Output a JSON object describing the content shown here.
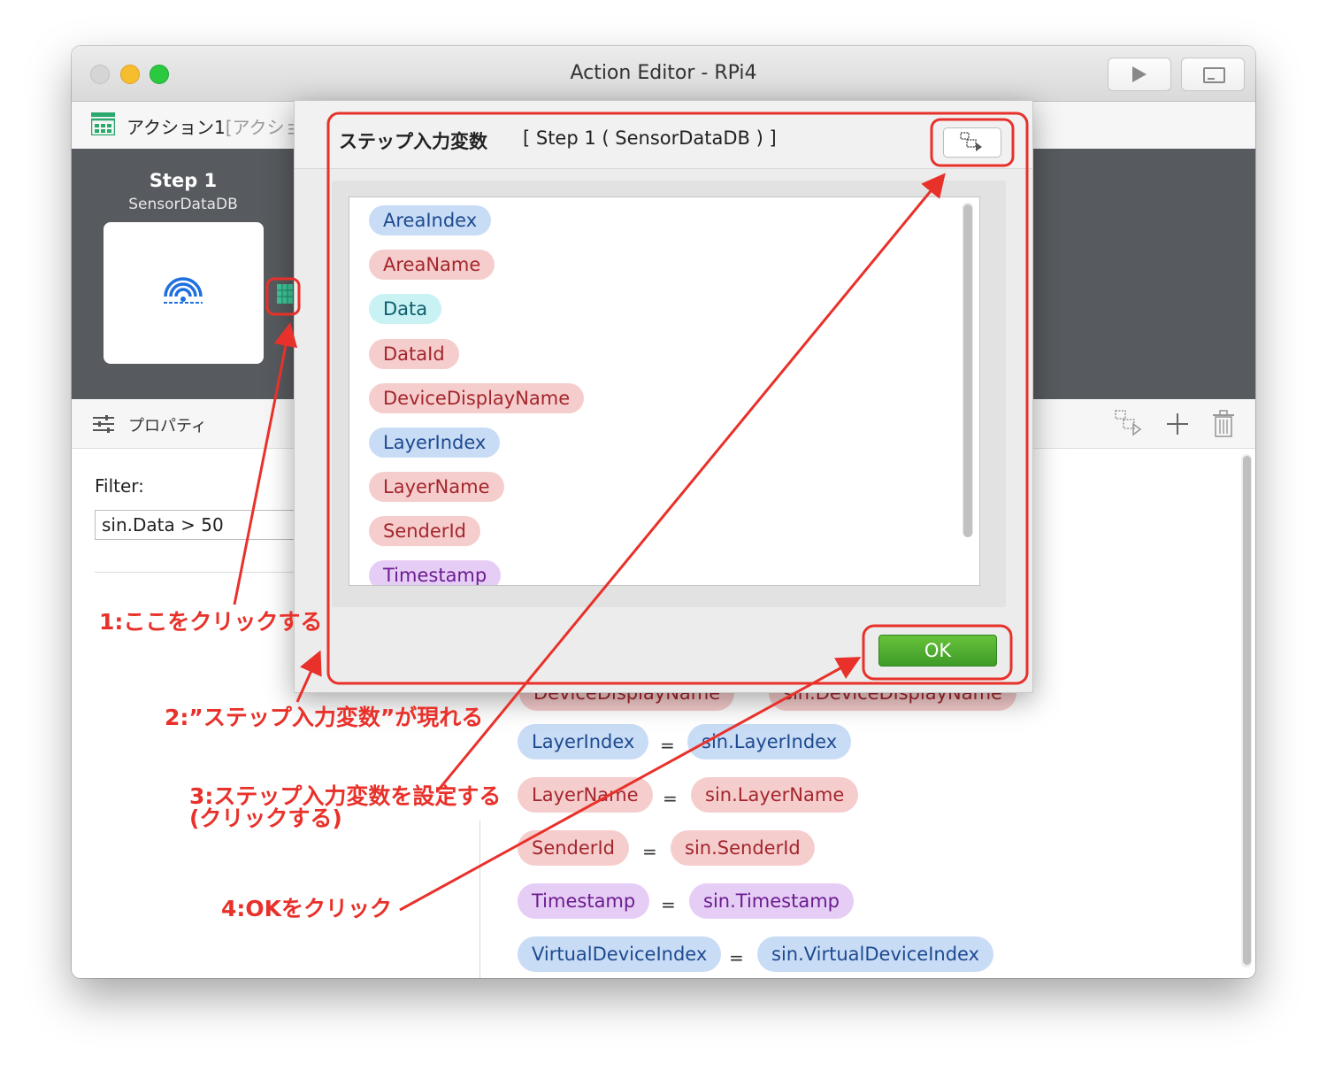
{
  "window": {
    "title": "Action Editor - RPi4"
  },
  "action": {
    "name": "アクション1",
    "subtitle": "[アクショ"
  },
  "step": {
    "title": "Step 1",
    "subtitle": "SensorDataDB"
  },
  "properties": {
    "label": "プロパティ"
  },
  "filter": {
    "label": "Filter:",
    "value": "sin.Data > 50"
  },
  "dialog": {
    "title": "ステップ入力変数",
    "step_label": "[ Step 1 ( SensorDataDB ) ]",
    "variables": [
      {
        "name": "AreaIndex",
        "color": "blue"
      },
      {
        "name": "AreaName",
        "color": "red"
      },
      {
        "name": "Data",
        "color": "cyan"
      },
      {
        "name": "DataId",
        "color": "red"
      },
      {
        "name": "DeviceDisplayName",
        "color": "red"
      },
      {
        "name": "LayerIndex",
        "color": "blue"
      },
      {
        "name": "LayerName",
        "color": "red"
      },
      {
        "name": "SenderId",
        "color": "red"
      },
      {
        "name": "Timestamp",
        "color": "purple"
      }
    ],
    "ok_label": "OK"
  },
  "mappings": {
    "partial_left": "DeviceDisplayName",
    "partial_right": "sin.DeviceDisplayName",
    "rows": [
      {
        "left": "LayerIndex",
        "op": "=",
        "right": "sin.LayerIndex",
        "color": "blue"
      },
      {
        "left": "LayerName",
        "op": "=",
        "right": "sin.LayerName",
        "color": "red"
      },
      {
        "left": "SenderId",
        "op": "=",
        "right": "sin.SenderId",
        "color": "red"
      },
      {
        "left": "Timestamp",
        "op": "=",
        "right": "sin.Timestamp",
        "color": "purple"
      },
      {
        "left": "VirtualDeviceIndex",
        "op": "=",
        "right": "sin.VirtualDeviceIndex",
        "color": "blue"
      }
    ]
  },
  "annotations": {
    "a1": "1:ここをクリックする",
    "a2": "2:”ステップ入力変数”が現れる",
    "a3_line1": "3:ステップ入力変数を設定する",
    "a3_line2": "(クリックする)",
    "a4": "4:OKをクリック"
  },
  "colors": {
    "annotation": "#e8312a",
    "ok_green": "#4caf30",
    "chip_blue": "#c9dcf6",
    "chip_red": "#f6cdcd",
    "chip_purple": "#e6cdf6",
    "chip_cyan": "#c8f2f4"
  },
  "icons": {
    "sensor": "wifi-sensor-icon",
    "output_table": "table-icon",
    "properties": "sliders-icon",
    "copy_vars": "copy-variables-icon",
    "add": "plus-icon",
    "delete": "trash-icon"
  }
}
